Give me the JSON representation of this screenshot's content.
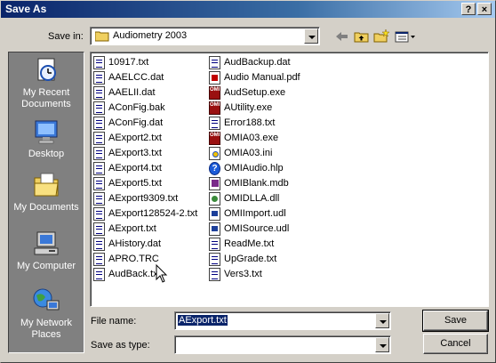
{
  "window": {
    "title": "Save As",
    "help_label": "?",
    "close_label": "×"
  },
  "savein": {
    "label": "Save in:",
    "value": "Audiometry 2003"
  },
  "places": [
    {
      "label": "My Recent Documents",
      "icon": "recent-documents-icon"
    },
    {
      "label": "Desktop",
      "icon": "desktop-icon"
    },
    {
      "label": "My Documents",
      "icon": "my-documents-icon"
    },
    {
      "label": "My Computer",
      "icon": "my-computer-icon"
    },
    {
      "label": "My Network Places",
      "icon": "network-places-icon"
    }
  ],
  "files_col1": [
    {
      "name": "10917.txt",
      "icon": "doc"
    },
    {
      "name": "AAELCC.dat",
      "icon": "doc"
    },
    {
      "name": "AAELII.dat",
      "icon": "doc"
    },
    {
      "name": "AConFig.bak",
      "icon": "doc"
    },
    {
      "name": "AConFig.dat",
      "icon": "doc"
    },
    {
      "name": "AExport2.txt",
      "icon": "doc"
    },
    {
      "name": "AExport3.txt",
      "icon": "doc"
    },
    {
      "name": "AExport4.txt",
      "icon": "doc"
    },
    {
      "name": "AExport5.txt",
      "icon": "doc"
    },
    {
      "name": "AExport9309.txt",
      "icon": "doc"
    },
    {
      "name": "AExport128524-2.txt",
      "icon": "doc"
    },
    {
      "name": "AExport.txt",
      "icon": "doc"
    },
    {
      "name": "AHistory.dat",
      "icon": "doc"
    },
    {
      "name": "APRO.TRC",
      "icon": "doc"
    },
    {
      "name": "AudBack.txt",
      "icon": "doc"
    }
  ],
  "files_col2": [
    {
      "name": "AudBackup.dat",
      "icon": "doc"
    },
    {
      "name": "Audio Manual.pdf",
      "icon": "pdf"
    },
    {
      "name": "AudSetup.exe",
      "icon": "exe"
    },
    {
      "name": "AUtility.exe",
      "icon": "exe"
    },
    {
      "name": "Error188.txt",
      "icon": "doc"
    },
    {
      "name": "OMIA03.exe",
      "icon": "exe"
    },
    {
      "name": "OMIA03.ini",
      "icon": "cfg"
    },
    {
      "name": "OMIAudio.hlp",
      "icon": "help"
    },
    {
      "name": "OMIBlank.mdb",
      "icon": "mdb"
    },
    {
      "name": "OMIDLLA.dll",
      "icon": "dll"
    },
    {
      "name": "OMIImport.udl",
      "icon": "udl"
    },
    {
      "name": "OMISource.udl",
      "icon": "udl"
    },
    {
      "name": "ReadMe.txt",
      "icon": "doc"
    },
    {
      "name": "UpGrade.txt",
      "icon": "doc"
    },
    {
      "name": "Vers3.txt",
      "icon": "doc"
    }
  ],
  "filename": {
    "label": "File name:",
    "value": "AExport.txt"
  },
  "savetype": {
    "label": "Save as type:",
    "value": ""
  },
  "buttons": {
    "save": "Save",
    "cancel": "Cancel"
  },
  "colors": {
    "titlebar": "#0a246a",
    "face": "#d4d0c8",
    "places_bg": "#808080"
  }
}
